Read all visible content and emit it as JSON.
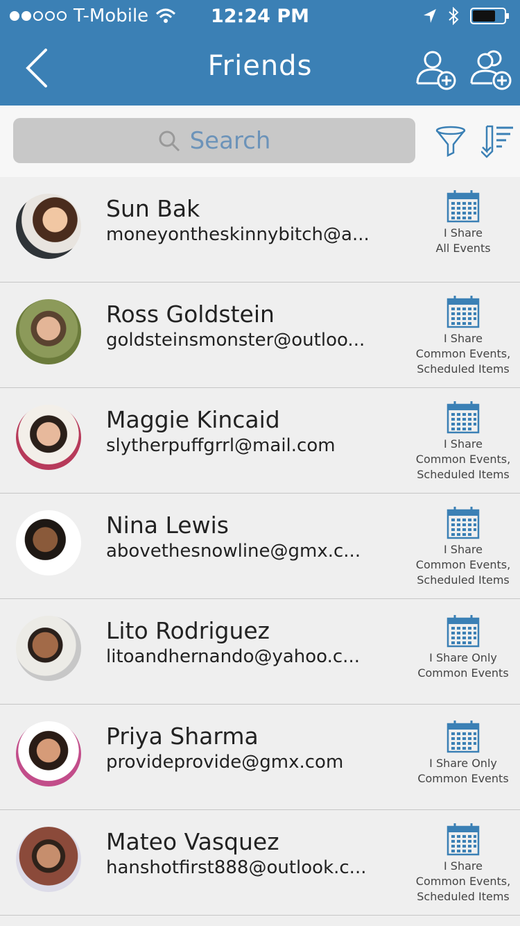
{
  "status": {
    "carrier": "T-Mobile",
    "time": "12:24 PM"
  },
  "nav": {
    "title": "Friends"
  },
  "search": {
    "placeholder": "Search"
  },
  "friends": [
    {
      "name": "Sun Bak",
      "email": "moneyontheskinnybitch@a...",
      "share1": "I Share",
      "share2": "All Events",
      "share3": ""
    },
    {
      "name": "Ross Goldstein",
      "email": "goldsteinsmonster@outloo...",
      "share1": "I Share",
      "share2": "Common Events,",
      "share3": "Scheduled Items"
    },
    {
      "name": "Maggie Kincaid",
      "email": "slytherpuffgrrl@mail.com",
      "share1": "I Share",
      "share2": "Common Events,",
      "share3": "Scheduled Items"
    },
    {
      "name": "Nina Lewis",
      "email": "abovethesnowline@gmx.c...",
      "share1": "I Share",
      "share2": "Common Events,",
      "share3": "Scheduled Items"
    },
    {
      "name": "Lito Rodriguez",
      "email": "litoandhernando@yahoo.c...",
      "share1": "I Share Only",
      "share2": "Common Events",
      "share3": ""
    },
    {
      "name": "Priya Sharma",
      "email": "provideprovide@gmx.com",
      "share1": "I Share Only",
      "share2": "Common Events",
      "share3": ""
    },
    {
      "name": "Mateo Vasquez",
      "email": "hanshotfirst888@outlook.c...",
      "share1": "I Share",
      "share2": "Common Events,",
      "share3": "Scheduled Items"
    }
  ],
  "colors": {
    "bar": "#3b80b5",
    "icon": "#3b80b5",
    "search_text": "#6c93b9"
  }
}
